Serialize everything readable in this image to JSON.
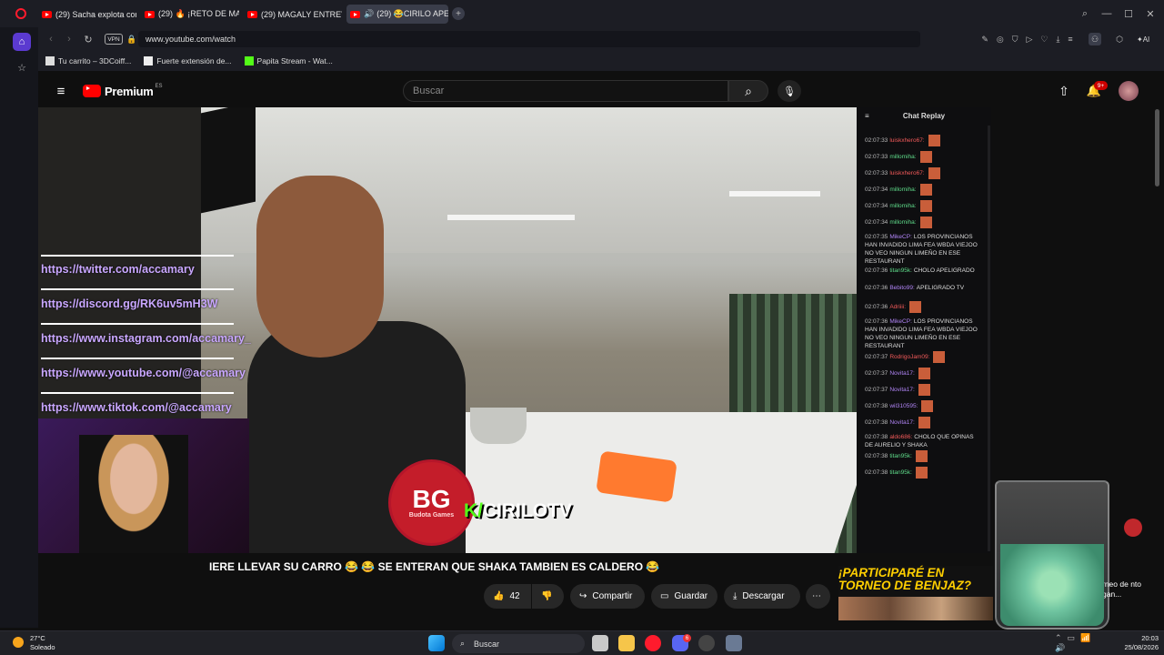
{
  "browser": {
    "tabs": [
      {
        "label": "(29) Sacha explota contra"
      },
      {
        "label": "(29) 🔥 ¡RETO DE MARATO"
      },
      {
        "label": "(29) MAGALY ENTREVISTA"
      },
      {
        "label": "(29) 😂CIRILO APELIG"
      }
    ],
    "url": "www.youtube.com/watch",
    "vpn_label": "VPN",
    "bookmarks": [
      {
        "label": "Tu carrito – 3DCoiff..."
      },
      {
        "label": "Fuerte extensión de..."
      },
      {
        "label": "Papita Stream - Wat..."
      }
    ],
    "ai_label": "AI"
  },
  "youtube": {
    "logo": "Premium",
    "region": "ES",
    "search_placeholder": "Buscar",
    "notif_count": "9+"
  },
  "video": {
    "overlay_links": [
      "https://twitter.com/accamary",
      "https://discord.gg/RK6uv5mH3W",
      "https://www.instagram.com/accamary_",
      "https://www.youtube.com/@accamary",
      "https://www.tiktok.com/@accamary"
    ],
    "logo_big": "BG",
    "logo_small": "Budota Games",
    "kick_prefix": "K/",
    "kick_name": "CIRILOTV",
    "subtitle": "IERE LLEVAR SU CARRO 😂 😂 SE ENTERAN QUE SHAKA TAMBIEN ES CALDERO 😂"
  },
  "chat": {
    "title": "Chat Replay",
    "messages": [
      {
        "time": "02:07:33",
        "user": "luiskxhero67:",
        "text": "",
        "color": "r"
      },
      {
        "time": "02:07:33",
        "user": "millomiha:",
        "text": "",
        "color": "g"
      },
      {
        "time": "02:07:33",
        "user": "luiskxhero67:",
        "text": "",
        "color": "r"
      },
      {
        "time": "02:07:34",
        "user": "millomiha:",
        "text": "",
        "color": "g"
      },
      {
        "time": "02:07:34",
        "user": "millomiha:",
        "text": "",
        "color": "g"
      },
      {
        "time": "02:07:34",
        "user": "millomiha:",
        "text": "",
        "color": "g"
      },
      {
        "time": "02:07:35",
        "user": "MikeCP:",
        "text": "LOS PROVINCIANOS HAN INVADIDO LIMA FEA WBDA VIEJOO NO VEO NINGUN LIMEÑO EN ESE RESTAURANT",
        "color": "p"
      },
      {
        "time": "02:07:36",
        "user": "titan95k:",
        "text": "CHOLO APELIGRADO",
        "color": "g"
      },
      {
        "time": "02:07:36",
        "user": "Bebito99:",
        "text": "APELIGRADO TV",
        "color": "p"
      },
      {
        "time": "02:07:36",
        "user": "Adriiii:",
        "text": "",
        "color": "r"
      },
      {
        "time": "02:07:36",
        "user": "MikeCP:",
        "text": "LOS PROVINCIANOS HAN INVADIDO LIMA FEA WBDA VIEJOO NO VEO NINGUN LIMEÑO EN ESE RESTAURANT",
        "color": "p"
      },
      {
        "time": "02:07:37",
        "user": "RodrigoJam09:",
        "text": "",
        "color": "r"
      },
      {
        "time": "02:07:37",
        "user": "Novita17:",
        "text": "",
        "color": "p"
      },
      {
        "time": "02:07:37",
        "user": "Novita17:",
        "text": "",
        "color": "p"
      },
      {
        "time": "02:07:38",
        "user": "wil310595:",
        "text": "",
        "color": "p"
      },
      {
        "time": "02:07:38",
        "user": "Novita17:",
        "text": "",
        "color": "p"
      },
      {
        "time": "02:07:38",
        "user": "aldo686:",
        "text": "CHOLO QUE OPINAS DE AURELIO Y SHAKA",
        "color": "r"
      },
      {
        "time": "02:07:38",
        "user": "titan95k:",
        "text": "",
        "color": "g"
      },
      {
        "time": "02:07:38",
        "user": "titan95k:",
        "text": "",
        "color": "g"
      }
    ]
  },
  "actions": {
    "likes": "42",
    "share": "Compartir",
    "save": "Guardar",
    "download": "Descargar"
  },
  "promo": {
    "title": "¡PARTICIPARÉ EN TORNEO DE BENJAZ?",
    "side_text": "rneo de nto gan..."
  },
  "taskbar": {
    "temp": "27°C",
    "weather": "Soleado",
    "search": "Buscar",
    "time": "20:03",
    "date": "25/08/2026",
    "discord_badge": "6"
  }
}
